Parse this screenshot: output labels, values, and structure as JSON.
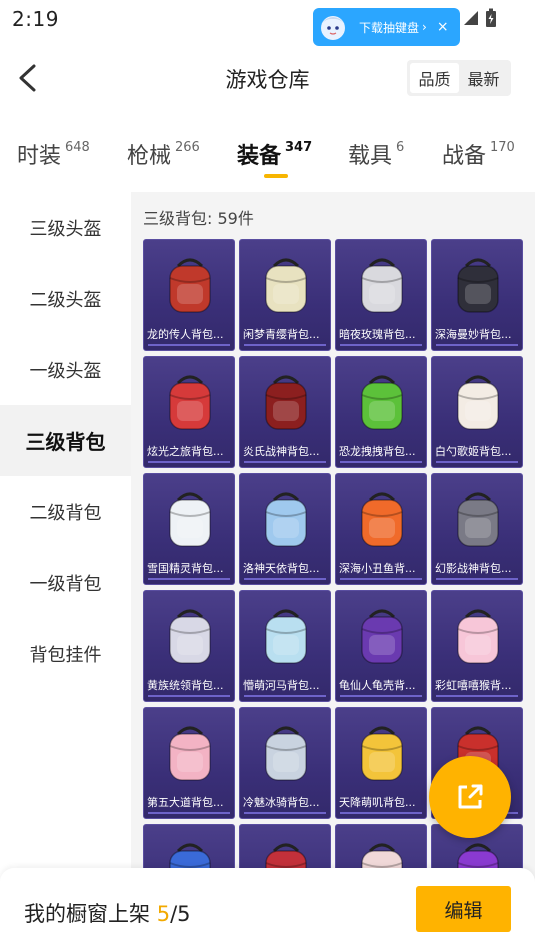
{
  "status_bar": {
    "time": "2:19"
  },
  "ad": {
    "text": "下载抽键盘",
    "arrow": "›",
    "close": "×"
  },
  "header": {
    "title": "游戏仓库",
    "sort_options": [
      "品质",
      "最新"
    ],
    "active_sort": "品质"
  },
  "category_tabs": [
    {
      "label": "时装",
      "count": "648"
    },
    {
      "label": "枪械",
      "count": "266"
    },
    {
      "label": "装备",
      "count": "347",
      "active": true
    },
    {
      "label": "载具",
      "count": "6"
    },
    {
      "label": "战备",
      "count": "170"
    }
  ],
  "sidebar": {
    "items": [
      "三级头盔",
      "二级头盔",
      "一级头盔",
      "三级背包",
      "二级背包",
      "一级背包",
      "背包挂件"
    ],
    "active": "三级背包"
  },
  "content": {
    "heading": "三级背包: 59件",
    "items": [
      {
        "name": "龙的传人背包...",
        "color": "#c0392b"
      },
      {
        "name": "闲梦青缨背包...",
        "color": "#e8e2c0"
      },
      {
        "name": "暗夜玫瑰背包...",
        "color": "#d9d9de"
      },
      {
        "name": "深海曼妙背包...",
        "color": "#2f2f3a"
      },
      {
        "name": "炫光之旅背包...",
        "color": "#d63a3a"
      },
      {
        "name": "炎氏战神背包...",
        "color": "#8c1f1f"
      },
      {
        "name": "恐龙拽拽背包...",
        "color": "#5cc13a"
      },
      {
        "name": "白勺歌姬背包...",
        "color": "#f3ece4"
      },
      {
        "name": "雪国精灵背包...",
        "color": "#eef2f6"
      },
      {
        "name": "洛神天依背包...",
        "color": "#9fc9ee"
      },
      {
        "name": "深海小丑鱼背...",
        "color": "#f06a2a"
      },
      {
        "name": "幻影战神背包...",
        "color": "#7a7a86"
      },
      {
        "name": "黄族统领背包...",
        "color": "#d8d8e6"
      },
      {
        "name": "懵萌河马背包...",
        "color": "#b9dff0"
      },
      {
        "name": "龟仙人龟壳背...",
        "color": "#6a3ab0"
      },
      {
        "name": "彩虹嘻嘻猴背...",
        "color": "#f7c6d8"
      },
      {
        "name": "第五大道背包...",
        "color": "#f3b3c4"
      },
      {
        "name": "冷魅冰骑背包...",
        "color": "#c9d3e0"
      },
      {
        "name": "天降萌叽背包...",
        "color": "#f3c43a"
      },
      {
        "name": "",
        "color": "#c9302c"
      },
      {
        "name": "",
        "color": "#3a6ad8"
      },
      {
        "name": "",
        "color": "#c2303a"
      },
      {
        "name": "",
        "color": "#f0d8d8"
      },
      {
        "name": "",
        "color": "#8a3ad0"
      }
    ]
  },
  "showcase": {
    "label": "我的橱窗上架 ",
    "current": "5",
    "total": "/5"
  },
  "edit_label": "编辑",
  "colors": {
    "accent": "#ffb300",
    "card_bg": "#3a2f78",
    "tab_indicator": "#f7b500"
  }
}
